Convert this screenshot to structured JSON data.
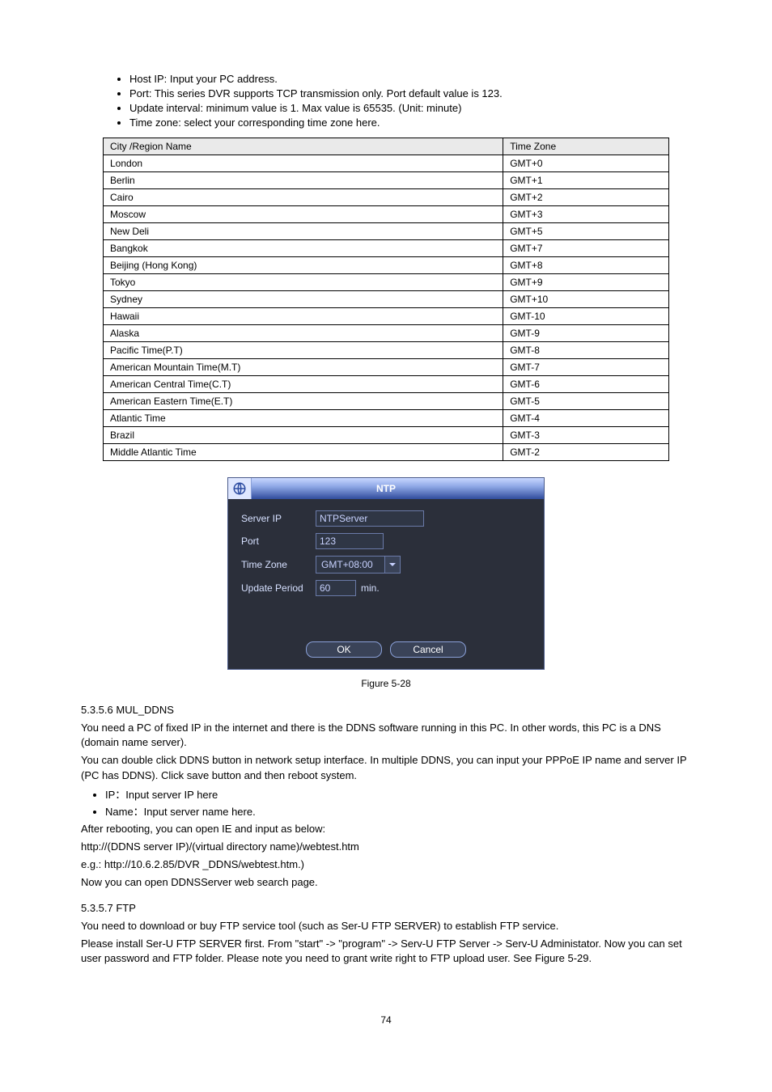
{
  "bullets": [
    "Host IP: Input your PC address.",
    "Port: This series DVR supports TCP transmission only. Port default value is 123.",
    "Update interval: minimum value is 1. Max value is 65535. (Unit: minute)",
    "Time zone: select your corresponding time zone here."
  ],
  "tztable": {
    "headers": [
      "City /Region Name",
      "Time Zone"
    ],
    "rows": [
      [
        "London",
        "GMT+0"
      ],
      [
        "Berlin",
        "GMT+1"
      ],
      [
        "Cairo",
        "GMT+2"
      ],
      [
        "Moscow",
        "GMT+3"
      ],
      [
        "New Deli",
        "GMT+5"
      ],
      [
        "Bangkok",
        "GMT+7"
      ],
      [
        "Beijing (Hong Kong)",
        "GMT+8"
      ],
      [
        "Tokyo",
        "GMT+9"
      ],
      [
        "Sydney",
        "GMT+10"
      ],
      [
        "Hawaii",
        "GMT-10"
      ],
      [
        "Alaska",
        "GMT-9"
      ],
      [
        "Pacific Time(P.T)",
        "GMT-8"
      ],
      [
        "American Mountain Time(M.T)",
        "GMT-7"
      ],
      [
        "American Central Time(C.T)",
        "GMT-6"
      ],
      [
        "American Eastern Time(E.T)",
        "GMT-5"
      ],
      [
        "Atlantic Time",
        "GMT-4"
      ],
      [
        "Brazil",
        "GMT-3"
      ],
      [
        "Middle Atlantic Time",
        "GMT-2"
      ]
    ]
  },
  "ntp": {
    "title": "NTP",
    "labels": {
      "serverip": "Server IP",
      "port": "Port",
      "timezone": "Time Zone",
      "updateperiod": "Update Period"
    },
    "values": {
      "serverip": "NTPServer",
      "port": "123",
      "timezone": "GMT+08:00",
      "updateperiod": "60",
      "unit": "min."
    },
    "buttons": {
      "ok": "OK",
      "cancel": "Cancel"
    }
  },
  "figcaption": "Figure 5-28",
  "section_heads": {
    "mul": "5.3.5.6 MUL_DDNS",
    "ftp": "5.3.5.7 FTP"
  },
  "paras": {
    "mul1": "You need a PC of fixed IP in the internet and there is the DDNS software running in this PC. In other words, this PC is a DNS (domain name server).",
    "mul2": "You can double click DDNS button in network setup interface. In multiple DDNS, you can input your PPPoE IP name and server IP (PC has DDNS). Click save button and then reboot system.",
    "mul3": "After rebooting, you can open IE and input as below:",
    "mul4": "http://(DDNS server IP)/(virtual directory name)/webtest.htm",
    "mul5": "e.g.: http://10.6.2.85/DVR _DDNS/webtest.htm.)",
    "mul6": "Now you can open DDNSServer web search page.",
    "ftp1": "You need to download or buy FTP service tool (such as Ser-U FTP SERVER) to establish FTP service.",
    "ftp2": "Please install Ser-U FTP SERVER first. From \"start\" -> \"program\" -> Serv-U FTP Server -> Serv-U Administator. Now you can set user password and FTP folder. Please note you need to grant write right to FTP upload user. See Figure 5-29."
  },
  "sublist": [
    "IP：Input server IP here",
    "Name：Input server name here."
  ],
  "pagenum": "74"
}
